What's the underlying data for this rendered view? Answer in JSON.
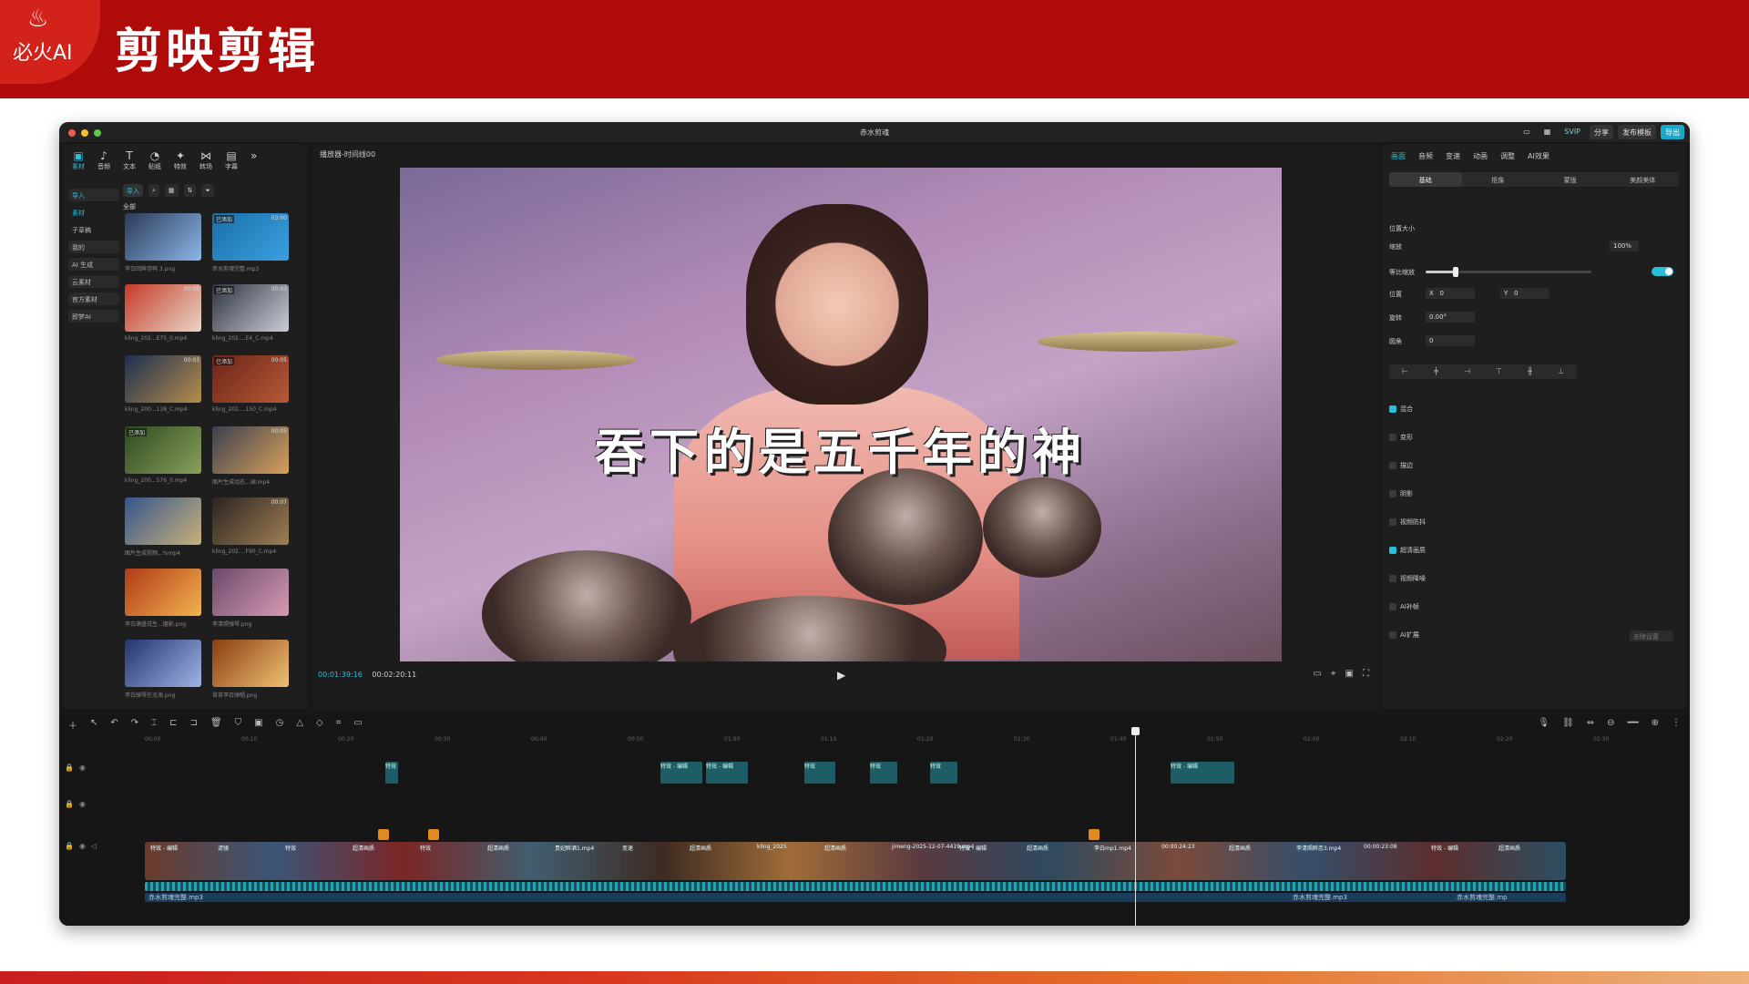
{
  "banner": {
    "logo_text": "必火AI",
    "title": "剪映剪辑"
  },
  "window": {
    "title": "赤水剪魂"
  },
  "topbar": {
    "buttons": [
      "SVIP",
      "分享",
      "发布模板",
      "导出"
    ]
  },
  "left_toolbar": {
    "items": [
      "素材",
      "音频",
      "文本",
      "贴纸",
      "特效",
      "转场",
      "字幕"
    ]
  },
  "left_side": {
    "items": [
      "导入",
      "素材",
      "子草稿",
      "我的",
      "AI 生成",
      "云素材",
      "官方素材",
      "即梦AI"
    ]
  },
  "media_bar": {
    "import_label": "导入"
  },
  "media_all": "全部",
  "media": [
    {
      "cap": "李白回眸侍鸭 3.png",
      "tag": "",
      "dur": "",
      "c1": "#2b3a58",
      "c2": "#8ab7e8"
    },
    {
      "cap": "赤水剪魂完整.mp3",
      "tag": "已添加",
      "dur": "03:00",
      "c1": "#1a6fa8",
      "c2": "#3ba0e0"
    },
    {
      "cap": "kling_202...E75_0.mp4",
      "tag": "",
      "dur": "00:05",
      "c1": "#c63a2a",
      "c2": "#e8d6c6"
    },
    {
      "cap": "kling_202....E4_C.mp4",
      "tag": "已添加",
      "dur": "00:03",
      "c1": "#2e3340",
      "c2": "#c9ced6"
    },
    {
      "cap": "kling_200...138_C.mp4",
      "tag": "",
      "dur": "00:03",
      "c1": "#1c2f50",
      "c2": "#b68d4c"
    },
    {
      "cap": "kling_202....150_C.mp4",
      "tag": "已添加",
      "dur": "00:05",
      "c1": "#6a2418",
      "c2": "#b85a36"
    },
    {
      "cap": "kling_200...576_0.mp4",
      "tag": "已添加",
      "dur": "",
      "c1": "#2f4a20",
      "c2": "#87a05a"
    },
    {
      "cap": "图片生成动态...澜.mp4",
      "tag": "",
      "dur": "00:05",
      "c1": "#3a3f4f",
      "c2": "#d9a15a"
    },
    {
      "cap": "图片生成视频...%mp4",
      "tag": "",
      "dur": "",
      "c1": "#34568c",
      "c2": "#c9b07a"
    },
    {
      "cap": "kling_202....F90_C.mp4",
      "tag": "",
      "dur": "00:07",
      "c1": "#2b2420",
      "c2": "#a07e55"
    },
    {
      "cap": "李白满盛戎生...擅影.png",
      "tag": "",
      "dur": "",
      "c1": "#b03a18",
      "c2": "#f2b34e"
    },
    {
      "cap": "李清照弹琴.png",
      "tag": "",
      "dur": "",
      "c1": "#6a4a6a",
      "c2": "#d69ab4"
    },
    {
      "cap": "李白弹琴在北海.png",
      "tag": "",
      "dur": "",
      "c1": "#23346e",
      "c2": "#9fb4e6"
    },
    {
      "cap": "苔苔李白弹唱.png",
      "tag": "",
      "dur": "",
      "c1": "#8a3c12",
      "c2": "#f0c272"
    }
  ],
  "player": {
    "header": "播放器-时间线00",
    "current": "00:01:39:16",
    "total": "00:02:20:11"
  },
  "subtitle_text": "吞下的是五千年的神",
  "right_tabs": [
    "画面",
    "音频",
    "变速",
    "动画",
    "调整",
    "AI效果"
  ],
  "right_subtabs": [
    "基础",
    "抠像",
    "蒙版",
    "美颜美体"
  ],
  "props": {
    "pos_size": "位置大小",
    "scale_label": "缩放",
    "scale_value": "100%",
    "scale_fraction": 0.18,
    "ratio_label": "等比缩放",
    "position_label": "位置",
    "x_label": "X",
    "x_value": "0",
    "y_label": "Y",
    "y_value": "0",
    "rotate_label": "旋转",
    "rotate_value": "0.00°",
    "corner_label": "圆角",
    "corner_value": "0",
    "options": [
      {
        "label": "混合",
        "on": true
      },
      {
        "label": "变形",
        "on": false
      },
      {
        "label": "描边",
        "on": false
      },
      {
        "label": "阴影",
        "on": false
      },
      {
        "label": "视频防抖",
        "on": false
      },
      {
        "label": "超清画质",
        "on": true
      },
      {
        "label": "视频降噪",
        "on": false
      },
      {
        "label": "AI补帧",
        "on": false
      },
      {
        "label": "AI扩展",
        "on": false
      }
    ],
    "ai_btn": "去除设置"
  },
  "ruler": [
    "00:00",
    "00:10",
    "00:20",
    "00:30",
    "00:40",
    "00:50",
    "01:00",
    "01:10",
    "01:20",
    "01:30",
    "01:40",
    "01:50",
    "02:00",
    "02:10",
    "02:20",
    "02:30"
  ],
  "fx_clips": [
    "特效",
    "特效 - 编辑",
    "特效 - 编辑",
    "特效",
    "特效",
    "特效",
    "特效 - 编辑"
  ],
  "main_clip_labels": [
    "特效 - 编辑",
    "滤镜",
    "特效",
    "超清画质",
    "特效",
    "超清画质",
    "贵妃醉酒1.mp4",
    "变速",
    "超清画质",
    "kling_2025",
    "超清画质",
    "jimeng-2025-12-07-4419.mp4",
    "特效 - 编辑",
    "超清画质",
    "李白mp1.mp4",
    "00:00:24:23",
    "超清画质",
    "李清照醉恋3.mp4",
    "00:00:23:08",
    "特效 - 编辑",
    "超清画质"
  ],
  "audio_labels": [
    "赤水剪魂完整.mp3",
    "赤水剪魂完整.mp3",
    "赤水剪魂完整.mp"
  ]
}
